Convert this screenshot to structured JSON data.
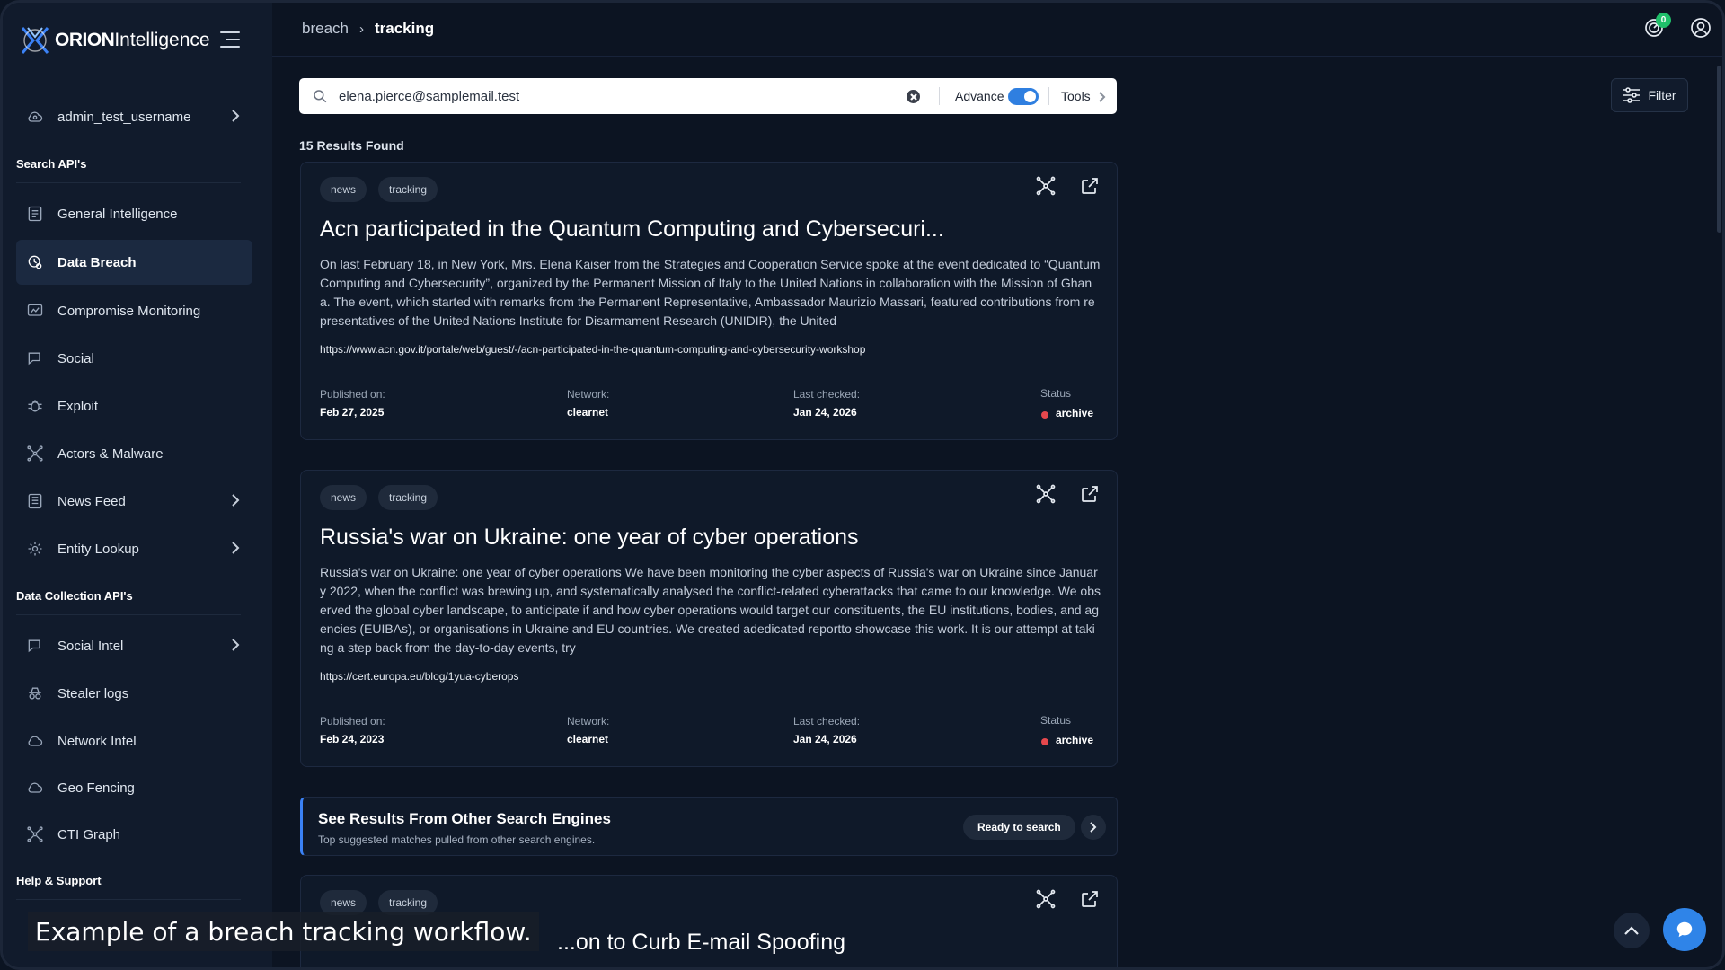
{
  "app": {
    "logo_bold": "ORION",
    "logo_regular": "Intelligence"
  },
  "user": {
    "name": "admin_test_username"
  },
  "sidebar": {
    "sections": {
      "search": "Search API's",
      "collection": "Data Collection API's",
      "help": "Help & Support"
    },
    "items": [
      {
        "label": "General Intelligence",
        "icon": "document-icon"
      },
      {
        "label": "Data Breach",
        "icon": "breach-icon",
        "active": true
      },
      {
        "label": "Compromise Monitoring",
        "icon": "monitor-icon"
      },
      {
        "label": "Social",
        "icon": "chat-icon"
      },
      {
        "label": "Exploit",
        "icon": "bug-icon"
      },
      {
        "label": "Actors & Malware",
        "icon": "network-icon"
      },
      {
        "label": "News Feed",
        "icon": "newspaper-icon"
      },
      {
        "label": "Entity Lookup",
        "icon": "gear-icon"
      },
      {
        "label": "Social Intel",
        "icon": "chat-icon"
      },
      {
        "label": "Stealer logs",
        "icon": "spy-icon"
      },
      {
        "label": "Network Intel",
        "icon": "cloud-icon"
      },
      {
        "label": "Geo Fencing",
        "icon": "cloud-icon"
      },
      {
        "label": "CTI Graph",
        "icon": "network-icon"
      }
    ]
  },
  "breadcrumb": {
    "parent": "breach",
    "current": "tracking"
  },
  "notifications": {
    "count": "0"
  },
  "search": {
    "value": "elena.pierce@samplemail.test",
    "advance_label": "Advance",
    "advance_on": true,
    "tools_label": "Tools"
  },
  "filter": {
    "label": "Filter"
  },
  "results": {
    "count_text": "15 Results Found",
    "cards": [
      {
        "tags": [
          "news",
          "tracking"
        ],
        "title": "Acn participated in the Quantum Computing and Cybersecuri...",
        "description": "On last February 18, in New York, Mrs. Elena Kaiser from the Strategies and Cooperation Service spoke at the event dedicated to “Quantum Computing and Cybersecurity”, organized by the Permanent Mission of Italy to the United Nations in collaboration with the Mission of Ghana. The event, which started with remarks from the Permanent Representative, Ambassador Maurizio Massari, featured contributions from representatives of the United Nations Institute for Disarmament Research (UNIDIR), the United",
        "url": "https://www.acn.gov.it/portale/web/guest/-/acn-participated-in-the-quantum-computing-and-cybersecurity-workshop",
        "published_label": "Published on:",
        "published": "Feb 27, 2025",
        "network_label": "Network:",
        "network": "clearnet",
        "checked_label": "Last checked:",
        "checked": "Jan 24, 2026",
        "status_label": "Status",
        "status": "archive"
      },
      {
        "tags": [
          "news",
          "tracking"
        ],
        "title": "Russia's war on Ukraine: one year of cyber operations",
        "description": "Russia's war on Ukraine: one year of cyber operations We have been monitoring the cyber aspects of Russia's war on Ukraine since January 2022, when the conflict was brewing up, and systematically analysed the conflict-related cyberattacks that came to our knowledge. We observed the global cyber landscape, to anticipate if and how cyber operations would target our constituents, the EU institutions, bodies, and agencies (EUIBAs), or organisations in Ukraine and EU countries. We created adedicated reportto showcase this work. It is our attempt at taking a step back from the day-to-day events, try",
        "url": "https://cert.europa.eu/blog/1yua-cyberops",
        "published_label": "Published on:",
        "published": "Feb 24, 2023",
        "network_label": "Network:",
        "network": "clearnet",
        "checked_label": "Last checked:",
        "checked": "Jan 24, 2026",
        "status_label": "Status",
        "status": "archive"
      },
      {
        "tags": [
          "news",
          "tracking"
        ],
        "title": "...on to Curb E-mail Spoofing"
      }
    ]
  },
  "engines": {
    "title": "See Results From Other Search Engines",
    "subtitle": "Top suggested matches pulled from other search engines.",
    "button": "Ready to search"
  },
  "caption": "Example of a breach tracking workflow.",
  "colors": {
    "background": "#0c1422",
    "sidebar": "#111b2c",
    "accent": "#2f7fe0",
    "status_archive": "#e5484d",
    "badge": "#1fbf6a"
  }
}
